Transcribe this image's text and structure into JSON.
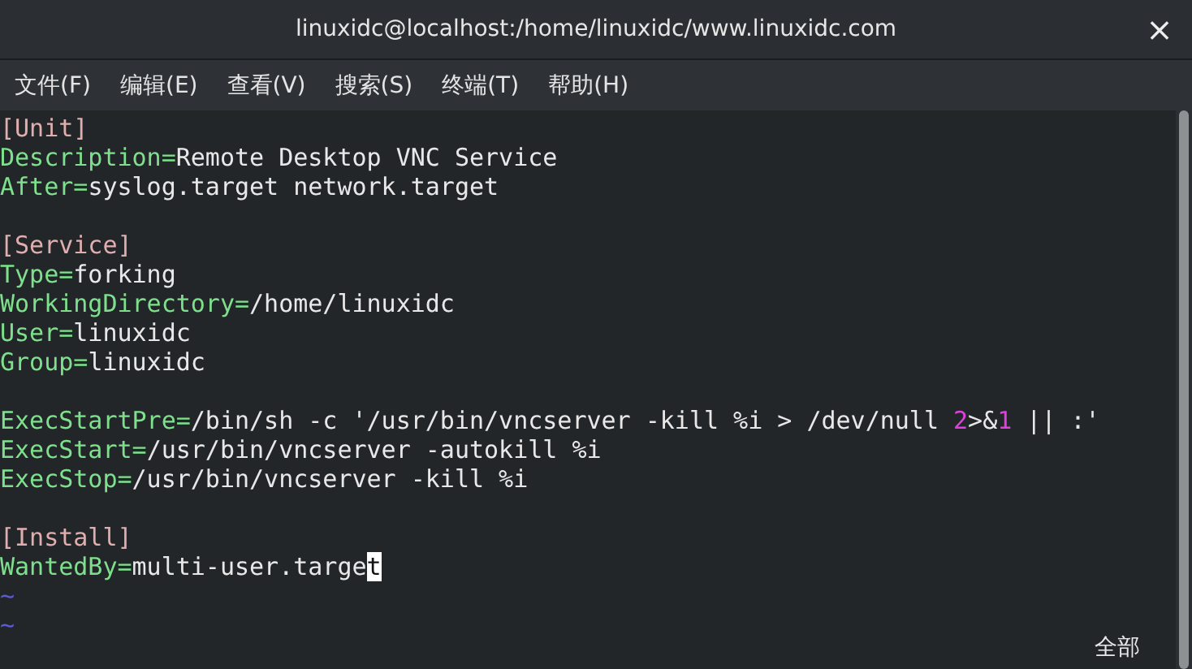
{
  "window": {
    "title": "linuxidc@localhost:/home/linuxidc/www.linuxidc.com",
    "close": "×"
  },
  "menu": [
    {
      "label": "文件(F)"
    },
    {
      "label": "编辑(E)"
    },
    {
      "label": "查看(V)"
    },
    {
      "label": "搜索(S)"
    },
    {
      "label": "终端(T)"
    },
    {
      "label": "帮助(H)"
    }
  ],
  "editor": {
    "lines": [
      {
        "kind": "text",
        "segments": [
          {
            "kind": "section",
            "text": "[Unit]"
          }
        ]
      },
      {
        "kind": "text",
        "segments": [
          {
            "kind": "key",
            "text": "Description="
          },
          {
            "kind": "value",
            "text": "Remote Desktop VNC Service"
          }
        ]
      },
      {
        "kind": "text",
        "segments": [
          {
            "kind": "key",
            "text": "After="
          },
          {
            "kind": "value",
            "text": "syslog.target network.target"
          }
        ]
      },
      {
        "kind": "blank"
      },
      {
        "kind": "text",
        "segments": [
          {
            "kind": "section",
            "text": "[Service]"
          }
        ]
      },
      {
        "kind": "text",
        "segments": [
          {
            "kind": "key",
            "text": "Type="
          },
          {
            "kind": "value",
            "text": "forking"
          }
        ]
      },
      {
        "kind": "text",
        "segments": [
          {
            "kind": "key",
            "text": "WorkingDirectory="
          },
          {
            "kind": "value",
            "text": "/home/linuxidc"
          }
        ]
      },
      {
        "kind": "text",
        "segments": [
          {
            "kind": "key",
            "text": "User="
          },
          {
            "kind": "value",
            "text": "linuxidc"
          }
        ]
      },
      {
        "kind": "text",
        "segments": [
          {
            "kind": "key",
            "text": "Group="
          },
          {
            "kind": "value",
            "text": "linuxidc"
          }
        ]
      },
      {
        "kind": "blank"
      },
      {
        "kind": "text",
        "segments": [
          {
            "kind": "key",
            "text": "ExecStartPre="
          },
          {
            "kind": "value",
            "text": "/bin/sh -c '/usr/bin/vncserver -kill %i > /dev/null "
          },
          {
            "kind": "number",
            "text": "2"
          },
          {
            "kind": "value",
            "text": ">&"
          },
          {
            "kind": "number",
            "text": "1"
          },
          {
            "kind": "value",
            "text": " || :'"
          }
        ]
      },
      {
        "kind": "text",
        "segments": [
          {
            "kind": "key",
            "text": "ExecStart="
          },
          {
            "kind": "value",
            "text": "/usr/bin/vncserver -autokill %i"
          }
        ]
      },
      {
        "kind": "text",
        "segments": [
          {
            "kind": "key",
            "text": "ExecStop="
          },
          {
            "kind": "value",
            "text": "/usr/bin/vncserver -kill %i"
          }
        ]
      },
      {
        "kind": "blank"
      },
      {
        "kind": "text",
        "segments": [
          {
            "kind": "section",
            "text": "[Install]"
          }
        ]
      },
      {
        "kind": "text",
        "segments": [
          {
            "kind": "key",
            "text": "WantedBy="
          },
          {
            "kind": "value",
            "text": "multi-user.targe"
          },
          {
            "kind": "cursor",
            "text": "t"
          }
        ]
      },
      {
        "kind": "tilde",
        "segments": [
          {
            "kind": "tilde",
            "text": "~"
          }
        ]
      },
      {
        "kind": "tilde",
        "segments": [
          {
            "kind": "tilde",
            "text": "~"
          }
        ]
      }
    ],
    "ruler": "全部"
  }
}
